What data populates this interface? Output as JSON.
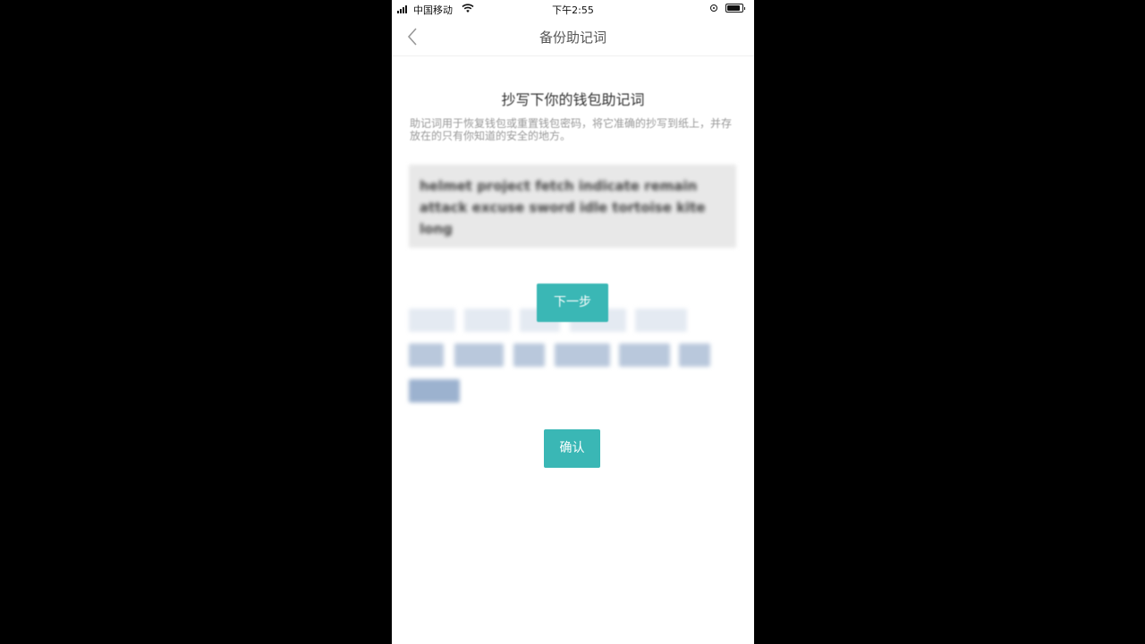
{
  "status_bar": {
    "carrier": "中国移动",
    "time": "下午2:55"
  },
  "nav": {
    "title": "备份助记词",
    "back_icon": "chevron-left-icon"
  },
  "page": {
    "heading": "抄写下你的钱包助记词",
    "description": "助记词用于恢复钱包或重置钱包密码，将它准确的抄写到纸上，并存放在的只有你知道的安全的地方。",
    "mnemonic": "helmet project fetch indicate remain attack excuse sword idle tortoise kite long"
  },
  "buttons": {
    "next_label": "下一步",
    "confirm_label": "确认"
  },
  "colors": {
    "accent": "#3ab7b5",
    "background": "#ffffff",
    "mnemonic_box": "#e8e8e8"
  }
}
